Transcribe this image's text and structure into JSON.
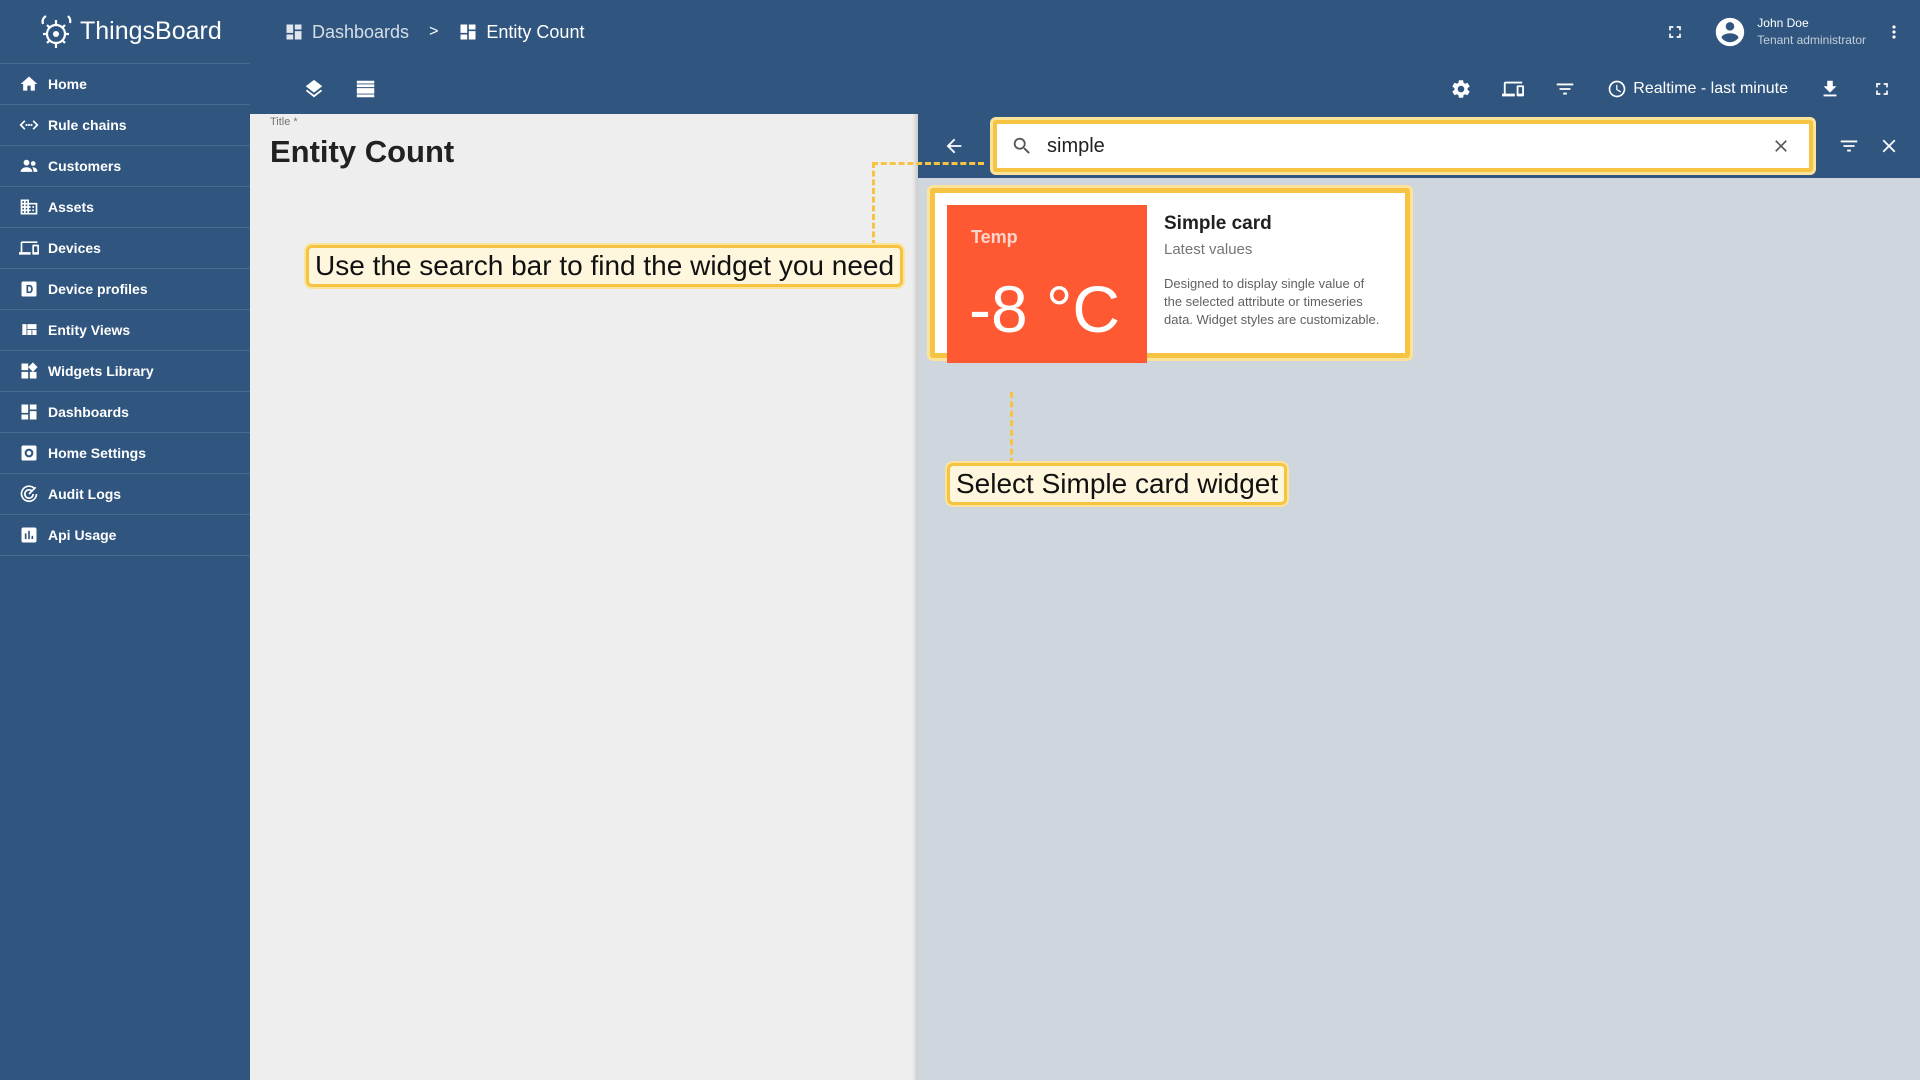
{
  "app": {
    "brand": "ThingsBoard"
  },
  "sidebar": {
    "items": [
      {
        "label": "Home",
        "icon": "home-icon"
      },
      {
        "label": "Rule chains",
        "icon": "code-arrows-icon"
      },
      {
        "label": "Customers",
        "icon": "people-icon"
      },
      {
        "label": "Assets",
        "icon": "building-icon"
      },
      {
        "label": "Devices",
        "icon": "devices-icon"
      },
      {
        "label": "Device profiles",
        "icon": "device-profile-icon"
      },
      {
        "label": "Entity Views",
        "icon": "view-quilt-icon"
      },
      {
        "label": "Widgets Library",
        "icon": "widgets-icon"
      },
      {
        "label": "Dashboards",
        "icon": "dashboard-icon"
      },
      {
        "label": "Home Settings",
        "icon": "settings-applications-icon"
      },
      {
        "label": "Audit Logs",
        "icon": "track-changes-icon"
      },
      {
        "label": "Api Usage",
        "icon": "insert-chart-icon"
      }
    ]
  },
  "header": {
    "breadcrumb": [
      {
        "label": "Dashboards",
        "icon": "dashboard-icon"
      },
      {
        "label": "Entity Count",
        "icon": "dashboard-icon"
      }
    ],
    "separator": ">",
    "user": {
      "name": "John Doe",
      "role": "Tenant administrator"
    }
  },
  "toolbar": {
    "timewindow_label": "Realtime - last minute"
  },
  "dashboard": {
    "title_label": "Title *",
    "title_value": "Entity Count"
  },
  "widget_panel": {
    "search_value": "simple",
    "results": [
      {
        "name": "Simple card",
        "type": "Latest values",
        "description": "Designed to display single value of the selected attribute or timeseries data. Widget styles are customizable.",
        "preview_label": "Temp",
        "preview_value": "-8 °C",
        "preview_color": "#fe5933"
      }
    ]
  },
  "callouts": {
    "search_hint": "Use the search bar to find the widget you need",
    "select_hint": "Select Simple card widget"
  },
  "colors": {
    "primary": "#305680",
    "highlight": "#f6c343",
    "panel_bg": "#d0d6dd",
    "canvas_bg": "#eeeeee"
  }
}
